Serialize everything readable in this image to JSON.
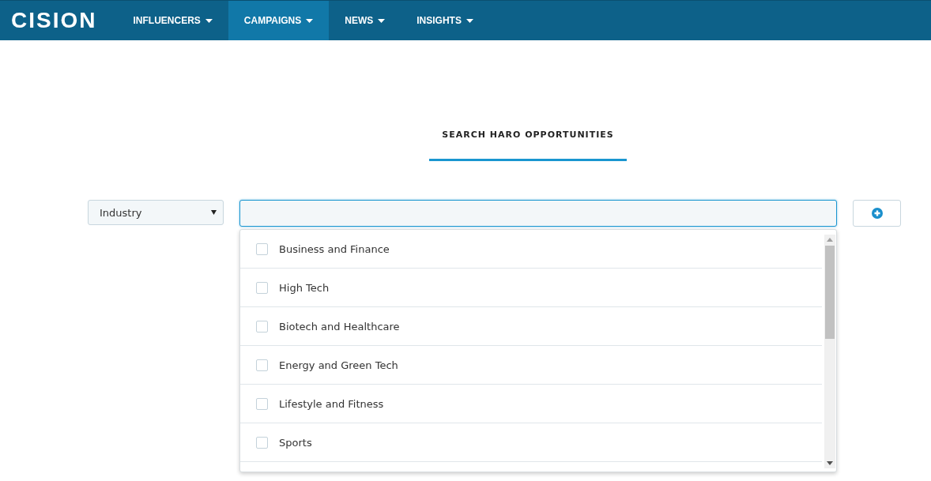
{
  "logo": "CISION",
  "nav": [
    {
      "label": "INFLUENCERS",
      "selected": false
    },
    {
      "label": "CAMPAIGNS",
      "selected": true
    },
    {
      "label": "NEWS",
      "selected": false
    },
    {
      "label": "INSIGHTS",
      "selected": false
    }
  ],
  "heading": "SEARCH HARO OPPORTUNITIES",
  "filter": {
    "value": "Industry"
  },
  "options": [
    {
      "label": "Business and Finance",
      "checked": false
    },
    {
      "label": "High Tech",
      "checked": false
    },
    {
      "label": "Biotech and Healthcare",
      "checked": false
    },
    {
      "label": "Energy and Green Tech",
      "checked": false
    },
    {
      "label": "Lifestyle and Fitness",
      "checked": false
    },
    {
      "label": "Sports",
      "checked": false
    }
  ]
}
